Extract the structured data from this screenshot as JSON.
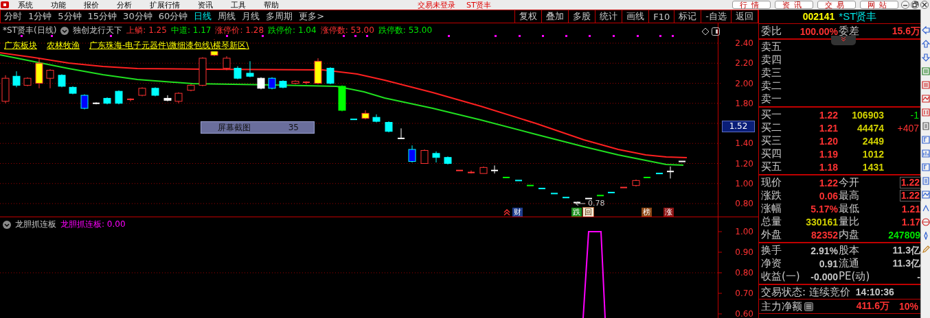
{
  "menu": {
    "items": [
      "系统",
      "功能",
      "报价",
      "分析",
      "扩展行情",
      "资讯",
      "工具",
      "帮助"
    ],
    "title": "交易未登录",
    "stock": "ST贤丰",
    "buttons": [
      "行情",
      "资讯",
      "交易",
      "网站"
    ]
  },
  "periods": [
    {
      "label": "分时",
      "selected": false
    },
    {
      "label": "1分钟",
      "selected": false
    },
    {
      "label": "5分钟",
      "selected": false
    },
    {
      "label": "15分钟",
      "selected": false
    },
    {
      "label": "30分钟",
      "selected": false
    },
    {
      "label": "60分钟",
      "selected": false
    },
    {
      "label": "日线",
      "selected": true
    },
    {
      "label": "周线",
      "selected": false
    },
    {
      "label": "月线",
      "selected": false
    },
    {
      "label": "多周期",
      "selected": false
    },
    {
      "label": "更多>",
      "selected": false
    }
  ],
  "tools": [
    "复权",
    "叠加",
    "多股",
    "统计",
    "画线",
    "F10",
    "标记",
    "-自选",
    "返回"
  ],
  "chart": {
    "title": "*ST贤丰(日线)",
    "indicator": "独创龙行天下",
    "legend": [
      {
        "label": "上鳞: 1.25",
        "color": "#ff3232"
      },
      {
        "label": "中道: 1.17",
        "color": "#00e600"
      },
      {
        "label": "涨停价: 1.28",
        "color": "#ff3232"
      },
      {
        "label": "跌停价: 1.04",
        "color": "#00e600"
      },
      {
        "label": "涨停数: 53.00",
        "color": "#ff3232"
      },
      {
        "label": "跌停数: 53.00",
        "color": "#00e600"
      }
    ],
    "tags": [
      "广东板块",
      "农林牧渔",
      "广东珠海-电子元器件\\微细漆包线\\横琴新区\\"
    ],
    "y_labels": [
      "2.40",
      "2.20",
      "2.00",
      "1.80",
      "1.40",
      "1.20",
      "1.00",
      "0.80"
    ],
    "crosshair_price": "1.52",
    "tooltip": {
      "label": "屏幕截图",
      "value": "35"
    },
    "low_note": "0.78",
    "markers": [
      {
        "label": "财",
        "color": "#1e3c8c"
      },
      {
        "label": "跌",
        "color": "#188c18"
      },
      {
        "label": "回",
        "color": "#f0e6d2"
      },
      {
        "label": "榜",
        "color": "#8c4614"
      },
      {
        "label": "涨",
        "color": "#8c1414"
      }
    ]
  },
  "indicator": {
    "title": "龙胆抓连板",
    "value_label": "龙胆抓连板: 0.00",
    "y_labels": [
      "1.00",
      "0.90",
      "0.80",
      "0.70",
      "0.60"
    ]
  },
  "quote": {
    "code": "002141",
    "name": "*ST贤丰",
    "ratio": [
      {
        "label": "委比",
        "value": "100.00%"
      },
      {
        "label": "委差",
        "value": "15.6万"
      }
    ],
    "sells": [
      "卖五",
      "卖四",
      "卖三",
      "卖二",
      "卖一"
    ],
    "buys": [
      {
        "label": "买一",
        "price": "1.22",
        "volume": "106903",
        "change": "-1",
        "color": "#00e600"
      },
      {
        "label": "买二",
        "price": "1.21",
        "volume": "44474",
        "change": "+407",
        "color": "#ff3232"
      },
      {
        "label": "买三",
        "price": "1.20",
        "volume": "2449"
      },
      {
        "label": "买四",
        "price": "1.19",
        "volume": "1012"
      },
      {
        "label": "买五",
        "price": "1.18",
        "volume": "1431"
      }
    ],
    "quotes": [
      {
        "label": "现价",
        "value": "1.22",
        "color": "#ff3232",
        "boxed": false
      },
      {
        "label": "今开",
        "value": "1.22",
        "color": "#ff3232",
        "boxed": true
      },
      {
        "label": "涨跌",
        "value": "0.06",
        "color": "#ff3232",
        "boxed": false
      },
      {
        "label": "最高",
        "value": "1.22",
        "color": "#ff3232",
        "boxed": true
      },
      {
        "label": "涨幅",
        "value": "5.17%",
        "color": "#ff3232",
        "boxed": false
      },
      {
        "label": "最低",
        "value": "1.21",
        "color": "#ff3232",
        "boxed": false
      },
      {
        "label": "总量",
        "value": "330161",
        "color": "#d2d200",
        "boxed": false
      },
      {
        "label": "量比",
        "value": "1.17",
        "color": "#ff3232",
        "boxed": false
      },
      {
        "label": "外盘",
        "value": "82352",
        "color": "#ff3232",
        "boxed": false
      },
      {
        "label": "内盘",
        "value": "247809",
        "color": "#00e600",
        "boxed": false
      }
    ],
    "stats": [
      {
        "label": "换手",
        "value": "2.91%"
      },
      {
        "label": "股本",
        "value": "11.3亿"
      },
      {
        "label": "净资",
        "value": "0.91"
      },
      {
        "label": "流通",
        "value": "11.3亿"
      },
      {
        "label": "收益(一)",
        "value": "-0.000"
      },
      {
        "label": "PE(动)",
        "value": "-"
      }
    ],
    "status": {
      "label": "交易状态: 连续竞价",
      "time": "14:10:36"
    },
    "main_flow": {
      "label": "主力净额",
      "amount": "411.6万",
      "percent": "10%"
    }
  }
}
